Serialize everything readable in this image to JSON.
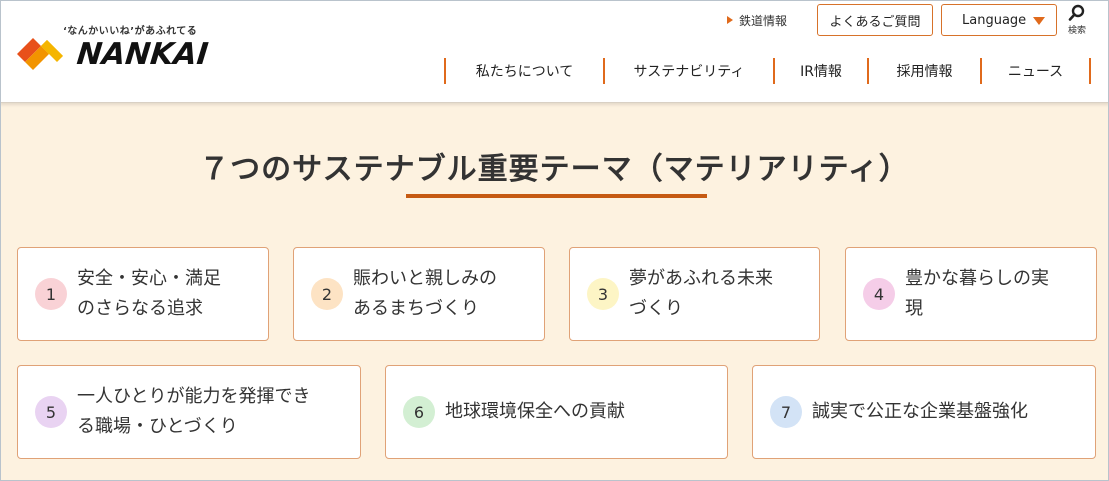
{
  "header": {
    "logo": {
      "tagline": "‘なんかいいね’があふれてる",
      "wordmark": "NANKAI",
      "icon": "nankai-diamond-logo-icon"
    },
    "utility": {
      "railway_info": "鉄道情報",
      "faq": "よくあるご質問",
      "language": "Language",
      "search": "検索",
      "search_icon": "magnifier-icon"
    },
    "nav": [
      {
        "label": "私たちについて"
      },
      {
        "label": "サステナビリティ"
      },
      {
        "label": "IR情報"
      },
      {
        "label": "採用情報"
      },
      {
        "label": "ニュース"
      }
    ]
  },
  "main": {
    "title": "７つのサステナブル重要テーマ（マテリアリティ）",
    "themes": [
      {
        "number": "1",
        "line1": "安全・安心・満足",
        "line2": "のさらなる追求",
        "color": "#f9d2d6"
      },
      {
        "number": "2",
        "line1": "賑わいと親しみの",
        "line2": "あるまちづくり",
        "color": "#fde3c4"
      },
      {
        "number": "3",
        "line1": "夢があふれる未来",
        "line2": "づくり",
        "color": "#fdf5c5"
      },
      {
        "number": "4",
        "line1": "豊かな暮らしの実",
        "line2": "現",
        "color": "#f5cde8"
      },
      {
        "number": "5",
        "line1": "一人ひとりが能力を発揮でき",
        "line2": "る職場・ひとづくり",
        "color": "#e9d3f2"
      },
      {
        "number": "6",
        "line1": "地球環境保全への貢献",
        "line2": "",
        "color": "#d3efd3"
      },
      {
        "number": "7",
        "line1": "誠実で公正な企業基盤強化",
        "line2": "",
        "color": "#d3e3f6"
      }
    ]
  },
  "colors": {
    "accent": "#e06a1c",
    "title_rule": "#c65a12",
    "background": "#fdf2e0",
    "card_border": "#e0a277"
  }
}
